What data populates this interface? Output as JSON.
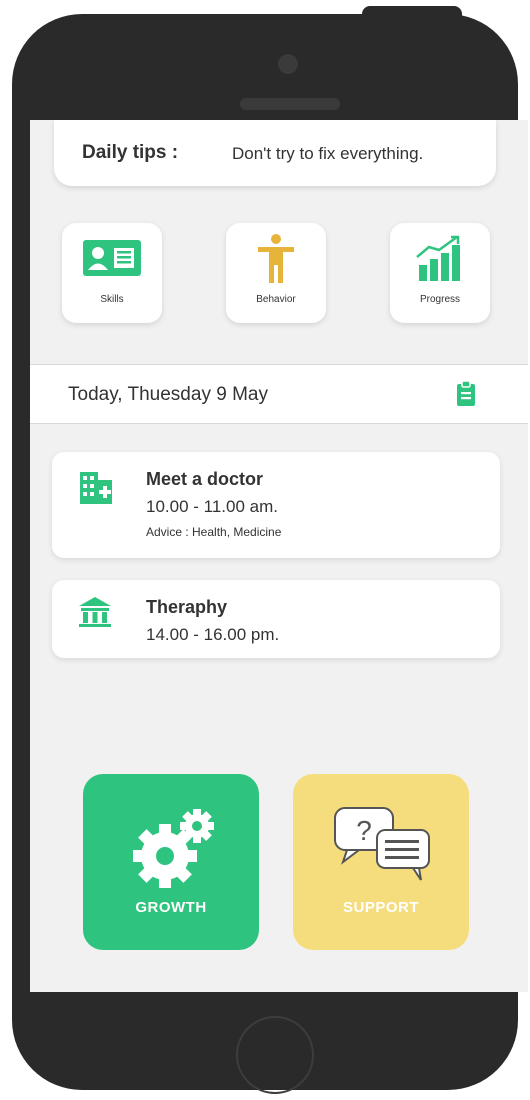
{
  "daily_tips": {
    "label": "Daily tips :",
    "text": "Don't try to fix everything."
  },
  "quick_actions": [
    {
      "label": "Skills",
      "icon": "id-card-icon"
    },
    {
      "label": "Behavior",
      "icon": "person-icon"
    },
    {
      "label": "Progress",
      "icon": "bar-chart-icon"
    }
  ],
  "date_header": {
    "text": "Today, Thuesday 9 May",
    "icon": "clipboard-icon"
  },
  "events": [
    {
      "title": "Meet a doctor",
      "time": "10.00 - 11.00 am.",
      "note": "Advice : Health, Medicine",
      "icon": "hospital-building-icon"
    },
    {
      "title": "Theraphy",
      "time": "14.00 - 16.00 pm.",
      "icon": "institution-icon"
    }
  ],
  "big_buttons": [
    {
      "label": "GROWTH",
      "icon": "gears-icon",
      "color": "#2ec47f"
    },
    {
      "label": "SUPPORT",
      "icon": "chat-question-icon",
      "color": "#f5dd7e"
    }
  ],
  "colors": {
    "accent_green": "#2ec47f",
    "accent_yellow": "#f5dd7e",
    "screen_bg": "#f1f1f1",
    "phone_body": "#2a2a2a"
  }
}
